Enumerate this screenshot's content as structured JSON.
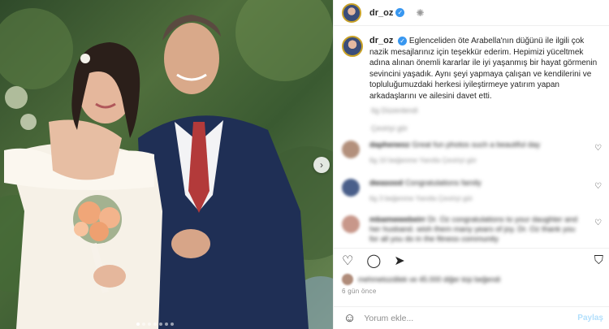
{
  "post": {
    "username": "dr_oz",
    "caption": "Eglenceliden öte Arabella'nın düğünü ile ilgili çok nazik mesajlarınız için teşekkür ederim. Hepimizi yüceltmek adına alınan önemli kararlar ile iyi yaşanmış bir hayat görmenin sevincini yaşadık. Aynı şeyi yapmaya çalışan ve kendilerini ve topluluğumuzdaki herkesi iyileştirmeye yatırım yapan arkadaşlarını ve ailesini davet etti.",
    "caption_meta_blurred": "6g Düzenlendi",
    "translate_blurred": "Çeviriyi gör",
    "time": "6 gün önce",
    "liked_by_blurred": "mehmetozdilek ve 45.000 diğer kişi beğendi"
  },
  "comments": [
    {
      "user_blurred": "dapheneoz",
      "text_blurred": "Great fun photos such a beautiful day",
      "meta_blurred": "6g 10 beğenme Yanıtla Çeviriyi gör",
      "avatar_color": "#b3907c"
    },
    {
      "user_blurred": "dwasood",
      "text_blurred": "Congratulations family",
      "meta_blurred": "6g 3 beğenme Yanıtla Çeviriyi gör",
      "avatar_color": "#4a5f8a"
    },
    {
      "user_blurred": "mbamwwebeirr",
      "text_blurred": "Dr. Oz congratulations to your daughter and her husband. wish them many years of joy. Dr. Oz thank you for all you do in the fitness community",
      "meta_blurred": "",
      "avatar_color": "#c8978a"
    }
  ],
  "add_comment": {
    "placeholder": "Yorum ekle...",
    "post_label": "Paylaş"
  },
  "carousel": {
    "slide_count": 7,
    "active_index": 0
  }
}
